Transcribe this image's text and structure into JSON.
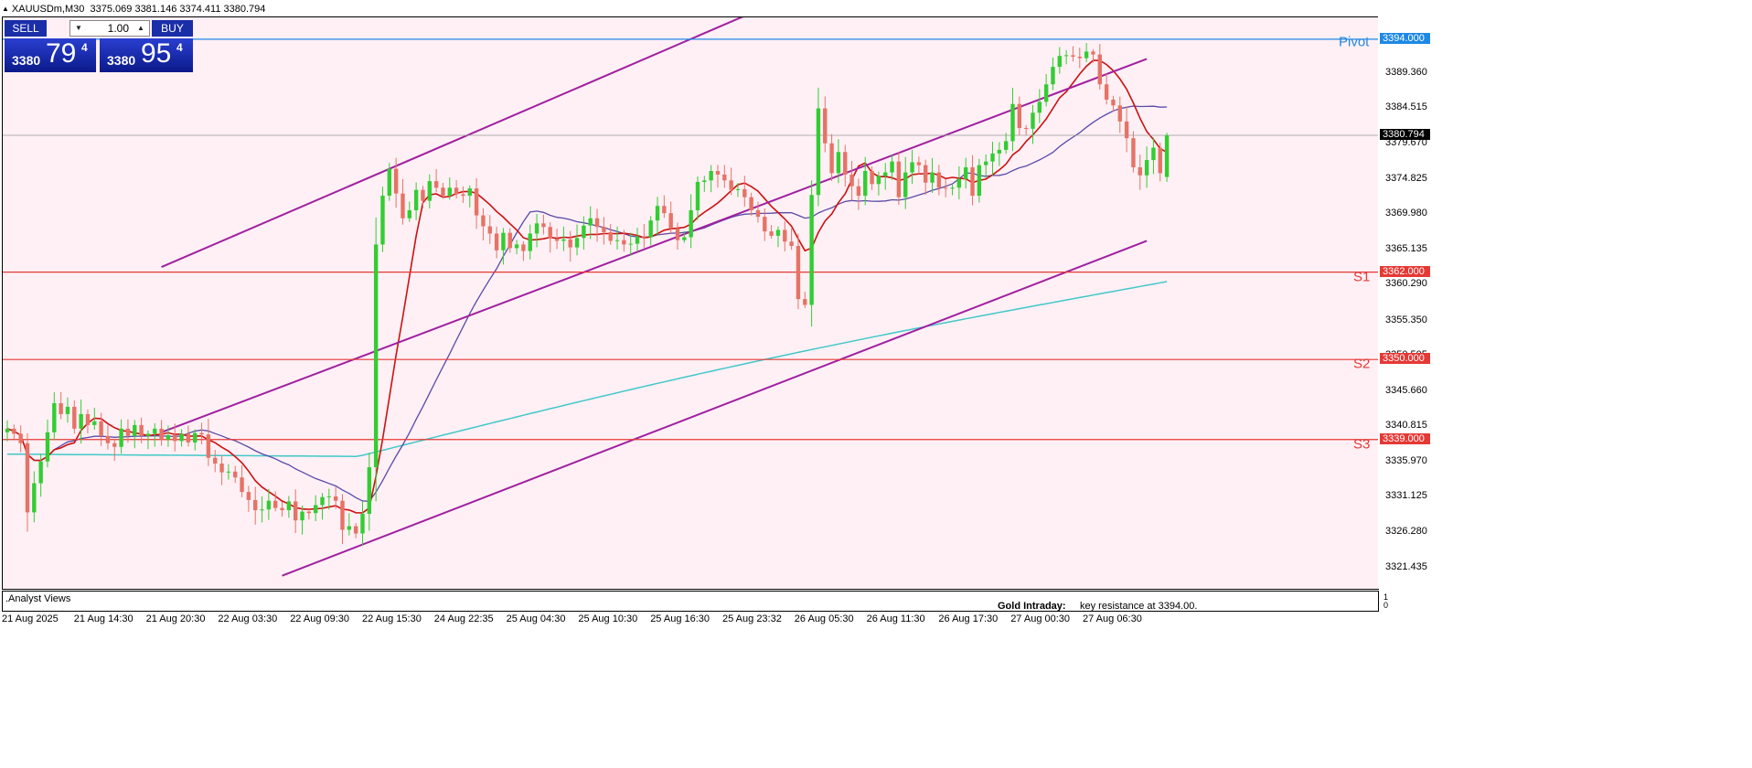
{
  "header": {
    "symbol_timeframe": "XAUUSDm,M30",
    "ohlc": "3375.069 3381.146 3374.411 3380.794"
  },
  "trade_panel": {
    "sell_label": "SELL",
    "buy_label": "BUY",
    "lot_value": "1.00",
    "sell_price_small": "3380",
    "sell_price_big": "79",
    "sell_price_sup": "4",
    "buy_price_small": "3380",
    "buy_price_big": "95",
    "buy_price_sup": "4",
    "sell_color": "#1a2ea8",
    "buy_color": "#1a2ea8"
  },
  "chart_data": {
    "type": "candlestick",
    "symbol": "XAUUSDm",
    "timeframe": "M30",
    "ylim": [
      3318.5,
      3397.0
    ],
    "y_ticks": [
      "3389.360",
      "3384.515",
      "3379.670",
      "3374.825",
      "3369.980",
      "3365.135",
      "3360.290",
      "3355.350",
      "3350.505",
      "3345.660",
      "3340.815",
      "3335.970",
      "3331.125",
      "3326.280",
      "3321.435"
    ],
    "x_ticks": [
      "21 Aug 2025",
      "21 Aug 14:30",
      "21 Aug 20:30",
      "22 Aug 03:30",
      "22 Aug 09:30",
      "22 Aug 15:30",
      "24 Aug 22:35",
      "25 Aug 04:30",
      "25 Aug 10:30",
      "25 Aug 16:30",
      "25 Aug 23:32",
      "26 Aug 05:30",
      "26 Aug 11:30",
      "26 Aug 17:30",
      "27 Aug 00:30",
      "27 Aug 06:30"
    ],
    "bar_count": 170,
    "last_bar": {
      "open": 3375.069,
      "high": 3381.146,
      "low": 3374.411,
      "close": 3380.794
    },
    "current_price": "3380.794",
    "levels": [
      {
        "name": "Pivot",
        "price": 3394.0,
        "label": "3394.000",
        "color": "#1e88e5"
      },
      {
        "name": "S1",
        "price": 3362.0,
        "label": "3362.000",
        "color": "#e53935"
      },
      {
        "name": "S2",
        "price": 3350.0,
        "label": "3350.000",
        "color": "#e53935"
      },
      {
        "name": "S3",
        "price": 3339.0,
        "label": "3339.000",
        "color": "#e53935"
      }
    ],
    "channel": {
      "color": "#a020a0",
      "upper": [
        [
          23,
          3362.7
        ],
        [
          112,
          3398.0
        ]
      ],
      "middle": [
        [
          23,
          3340.0
        ],
        [
          170,
          3391.3
        ]
      ],
      "lower": [
        [
          41,
          3320.3
        ],
        [
          170,
          3366.3
        ]
      ]
    },
    "candle_up_color": "#32cd32",
    "candle_down_color": "#e57366",
    "closes": [
      3340.5,
      3339.8,
      3338.5,
      3329,
      3333,
      3336,
      3340,
      3344,
      3342.5,
      3343.5,
      3340.5,
      3342.5,
      3341,
      3341.5,
      3339.5,
      3338.5,
      3338,
      3340.5,
      3339.5,
      3341,
      3339.5,
      3339.8,
      3340.5,
      3339,
      3339.6,
      3338.8,
      3339.8,
      3338.6,
      3339.9,
      3339.7,
      3336.5,
      3335.7,
      3334.5,
      3334.6,
      3333.8,
      3331.8,
      3330.7,
      3329.3,
      3329.4,
      3330.6,
      3329.6,
      3329.3,
      3330.5,
      3327.9,
      3329.1,
      3328.9,
      3330,
      3331.1,
      3331.2,
      3330.6,
      3326.6,
      3327.1,
      3326.1,
      3328.8,
      3335.2,
      3365.8,
      3372.5,
      3376.2,
      3372.8,
      3369.4,
      3370.5,
      3373.3,
      3371.8,
      3374.5,
      3373.6,
      3372.5,
      3373.6,
      3372.7,
      3372.5,
      3373.5,
      3369.8,
      3368.3,
      3367.3,
      3365,
      3367.4,
      3365.3,
      3365.8,
      3364.9,
      3367.3,
      3368.7,
      3368.2,
      3366.6,
      3366.3,
      3366.5,
      3365.4,
      3366.7,
      3368.4,
      3369.4,
      3368.2,
      3367.5,
      3366.3,
      3366.4,
      3365.8,
      3365.9,
      3366.9,
      3366.8,
      3369.1,
      3371.1,
      3370.1,
      3368,
      3366.4,
      3366.8,
      3370.5,
      3374.4,
      3374.6,
      3375.9,
      3375.4,
      3374.6,
      3373.3,
      3373.4,
      3372.3,
      3370.5,
      3369.6,
      3367.6,
      3367,
      3367.8,
      3366.2,
      3365.6,
      3358.3,
      3357.5,
      3372.6,
      3384.5,
      3379.7,
      3375.6,
      3378.5,
      3375.4,
      3373.8,
      3372.5,
      3375.9,
      3374.1,
      3375.2,
      3375.7,
      3377.2,
      3372.3,
      3375.7,
      3377.1,
      3376.7,
      3374.3,
      3375.7,
      3373.6,
      3373.5,
      3373.6,
      3374.8,
      3376.4,
      3372.5,
      3376.7,
      3377.2,
      3378.3,
      3378.8,
      3380,
      3385.1,
      3381.8,
      3381.7,
      3383.9,
      3385.4,
      3387.8,
      3390.2,
      3391.7,
      3391.8,
      3391.6,
      3391.4,
      3392.3,
      3391.9,
      3387.8,
      3385.7,
      3384.9,
      3382.7,
      3380.4,
      3376.4,
      3375.3,
      3377.4,
      3379.1,
      3375.6,
      3380.794
    ]
  },
  "sub_window": {
    "label": ".Analyst Views",
    "text_bold": "Gold Intraday:",
    "text_rest": "key resistance at 3394.00.",
    "axis_top": "1",
    "axis_bottom": "0"
  }
}
